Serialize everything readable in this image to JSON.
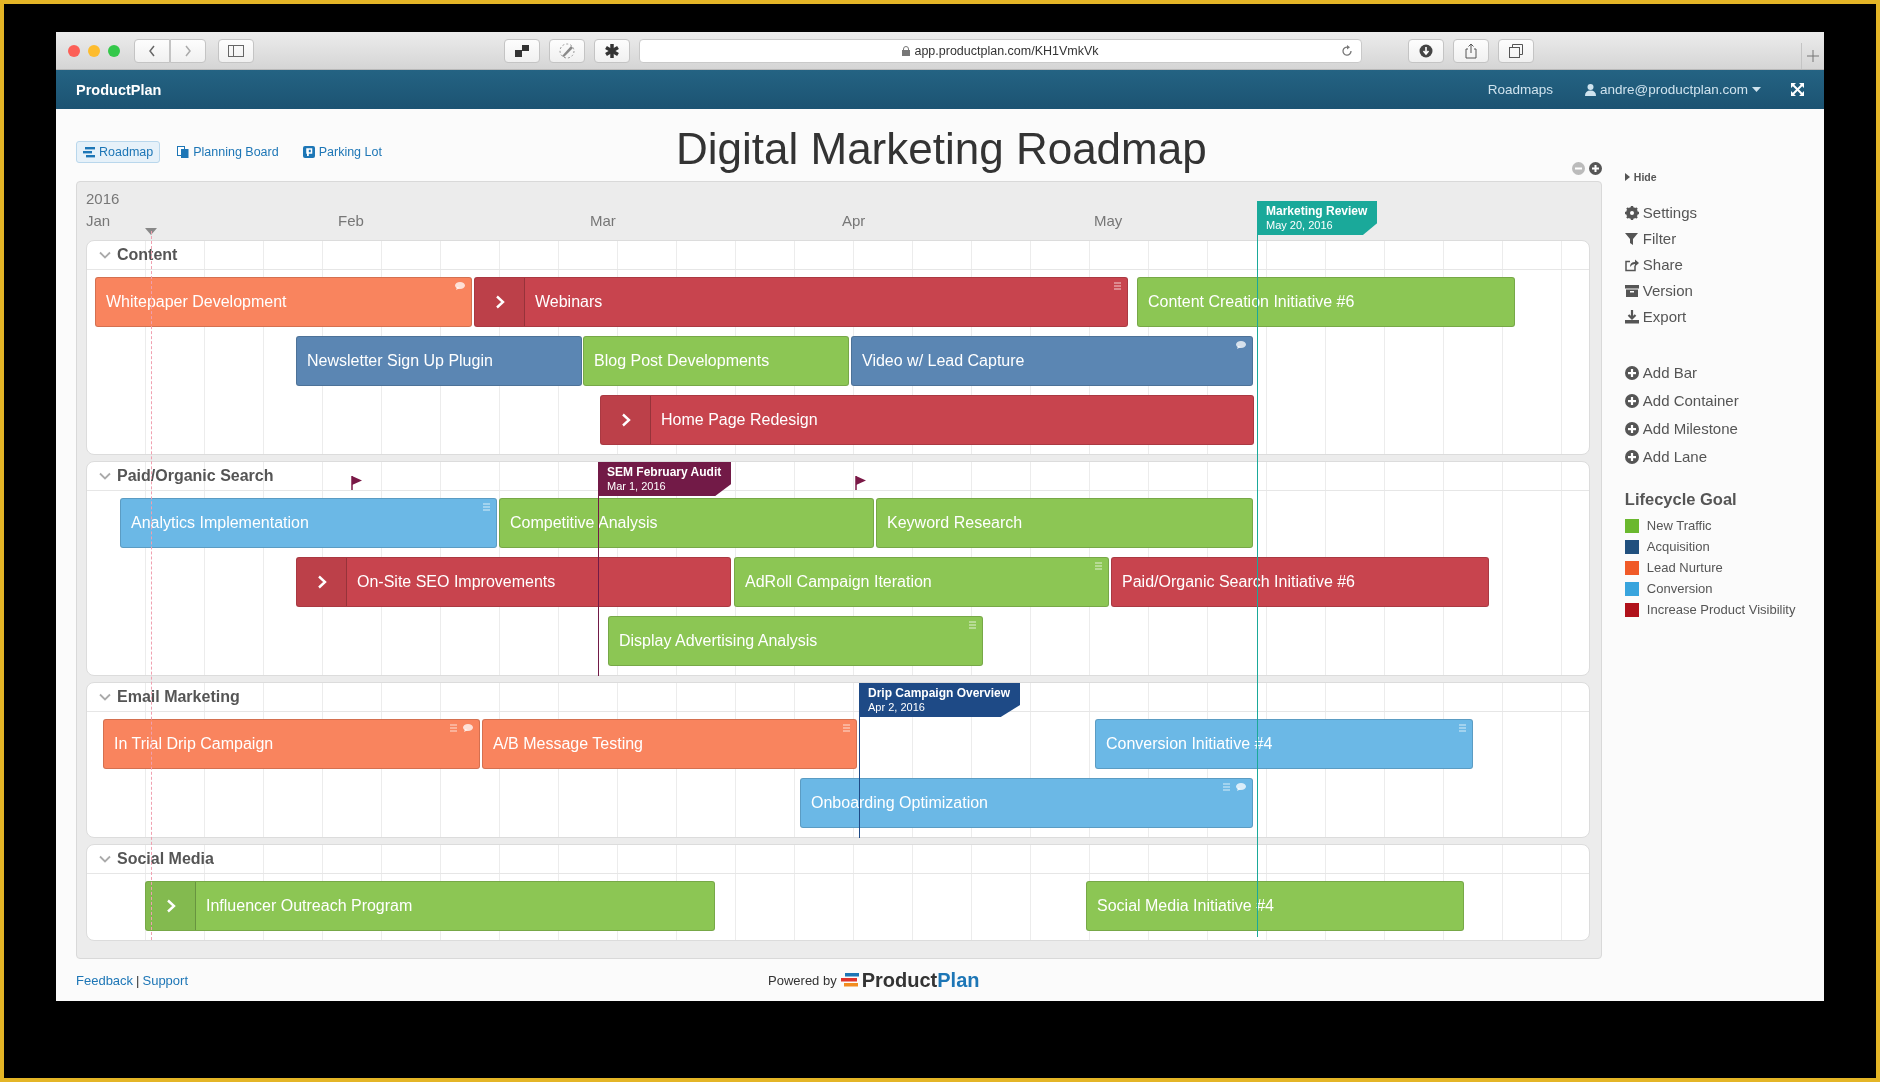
{
  "browser": {
    "url": "app.productplan.com/KH1VmkVk"
  },
  "app_header": {
    "brand": "ProductPlan",
    "nav": [
      "Roadmaps"
    ],
    "user": "andre@productplan.com"
  },
  "views": [
    {
      "label": "Roadmap",
      "selected": true
    },
    {
      "label": "Planning Board",
      "selected": false
    },
    {
      "label": "Parking Lot",
      "selected": false
    }
  ],
  "title": "Digital Marketing Roadmap",
  "timeline": {
    "year": "2016",
    "months": [
      "Jan",
      "Feb",
      "Mar",
      "Apr",
      "May"
    ],
    "milestone": {
      "title": "Marketing Review",
      "date": "May 20, 2016",
      "color": "#1aa99a"
    },
    "lanes": [
      {
        "name": "Content",
        "expanded": true,
        "rows": [
          {
            "bars": [
              {
                "label": "Whitepaper Development",
                "color": "#f9845e",
                "expandable": false,
                "notes": false,
                "comments": true
              },
              {
                "label": "Webinars",
                "color": "#c8444e",
                "expandable": true,
                "notes": true,
                "comments": false
              },
              {
                "label": "Content Creation Initiative #6",
                "color": "#8cc654",
                "expandable": false,
                "notes": false,
                "comments": false
              }
            ]
          },
          {
            "bars": [
              {
                "label": "Newsletter Sign Up Plugin",
                "color": "#5b86b3",
                "expandable": false,
                "notes": false,
                "comments": false
              },
              {
                "label": "Blog Post Developments",
                "color": "#8cc654",
                "expandable": false,
                "notes": false,
                "comments": false
              },
              {
                "label": "Video w/ Lead Capture",
                "color": "#5b86b3",
                "expandable": false,
                "notes": false,
                "comments": true
              }
            ]
          },
          {
            "bars": [
              {
                "label": "Home Page Redesign",
                "color": "#c8444e",
                "expandable": true,
                "notes": false,
                "comments": false
              }
            ]
          }
        ]
      },
      {
        "name": "Paid/Organic Search",
        "expanded": true,
        "milestones": [
          {
            "title": "SEM February Audit",
            "date": "Mar 1, 2016",
            "color": "#721a47"
          }
        ],
        "rows": [
          {
            "bars": [
              {
                "label": "Analytics Implementation",
                "color": "#6bb8e6",
                "expandable": false,
                "notes": true,
                "comments": false
              },
              {
                "label": "Competitive Analysis",
                "color": "#8cc654",
                "expandable": false,
                "notes": false,
                "comments": false
              },
              {
                "label": "Keyword Research",
                "color": "#8cc654",
                "expandable": false,
                "notes": false,
                "comments": false
              }
            ]
          },
          {
            "bars": [
              {
                "label": "On-Site SEO Improvements",
                "color": "#c8444e",
                "expandable": true,
                "notes": false,
                "comments": false
              },
              {
                "label": "AdRoll Campaign Iteration",
                "color": "#8cc654",
                "expandable": false,
                "notes": true,
                "comments": false
              },
              {
                "label": "Paid/Organic Search Initiative #6",
                "color": "#c8444e",
                "expandable": false,
                "notes": false,
                "comments": false
              }
            ]
          },
          {
            "bars": [
              {
                "label": "Display Advertising Analysis",
                "color": "#8cc654",
                "expandable": false,
                "notes": true,
                "comments": false
              }
            ]
          }
        ]
      },
      {
        "name": "Email Marketing",
        "expanded": true,
        "milestones": [
          {
            "title": "Drip Campaign Overview",
            "date": "Apr 2, 2016",
            "color": "#1e4a86"
          }
        ],
        "rows": [
          {
            "bars": [
              {
                "label": "In Trial Drip Campaign",
                "color": "#f9845e",
                "expandable": false,
                "notes": true,
                "comments": true
              },
              {
                "label": "A/B Message Testing",
                "color": "#f9845e",
                "expandable": false,
                "notes": true,
                "comments": false
              },
              {
                "label": "Conversion Initiative #4",
                "color": "#6bb8e6",
                "expandable": false,
                "notes": true,
                "comments": false
              }
            ]
          },
          {
            "bars": [
              {
                "label": "Onboarding Optimization",
                "color": "#6bb8e6",
                "expandable": false,
                "notes": true,
                "comments": true
              }
            ]
          }
        ]
      },
      {
        "name": "Social Media",
        "expanded": true,
        "rows": [
          {
            "bars": [
              {
                "label": "Influencer Outreach Program",
                "color": "#8cc654",
                "expandable": true,
                "notes": false,
                "comments": false
              },
              {
                "label": "Social Media Initiative #4",
                "color": "#8cc654",
                "expandable": false,
                "notes": false,
                "comments": false
              }
            ]
          }
        ]
      }
    ]
  },
  "sidebar": {
    "hide": "Hide",
    "actions": [
      "Settings",
      "Filter",
      "Share",
      "Version",
      "Export"
    ],
    "add_actions": [
      "Add Bar",
      "Add Container",
      "Add Milestone",
      "Add Lane"
    ],
    "legend": {
      "title": "Lifecycle Goal",
      "items": [
        {
          "label": "New Traffic",
          "color": "#6ab82e"
        },
        {
          "label": "Acquisition",
          "color": "#21507e"
        },
        {
          "label": "Lead Nurture",
          "color": "#f05a28"
        },
        {
          "label": "Conversion",
          "color": "#38a4dd"
        },
        {
          "label": "Increase Product Visibility",
          "color": "#b0121b"
        }
      ]
    }
  },
  "footer": {
    "links": [
      "Feedback",
      "Support"
    ],
    "separator": "|",
    "powered_by": "Powered by",
    "wordmark": [
      "Product",
      "Plan"
    ]
  }
}
